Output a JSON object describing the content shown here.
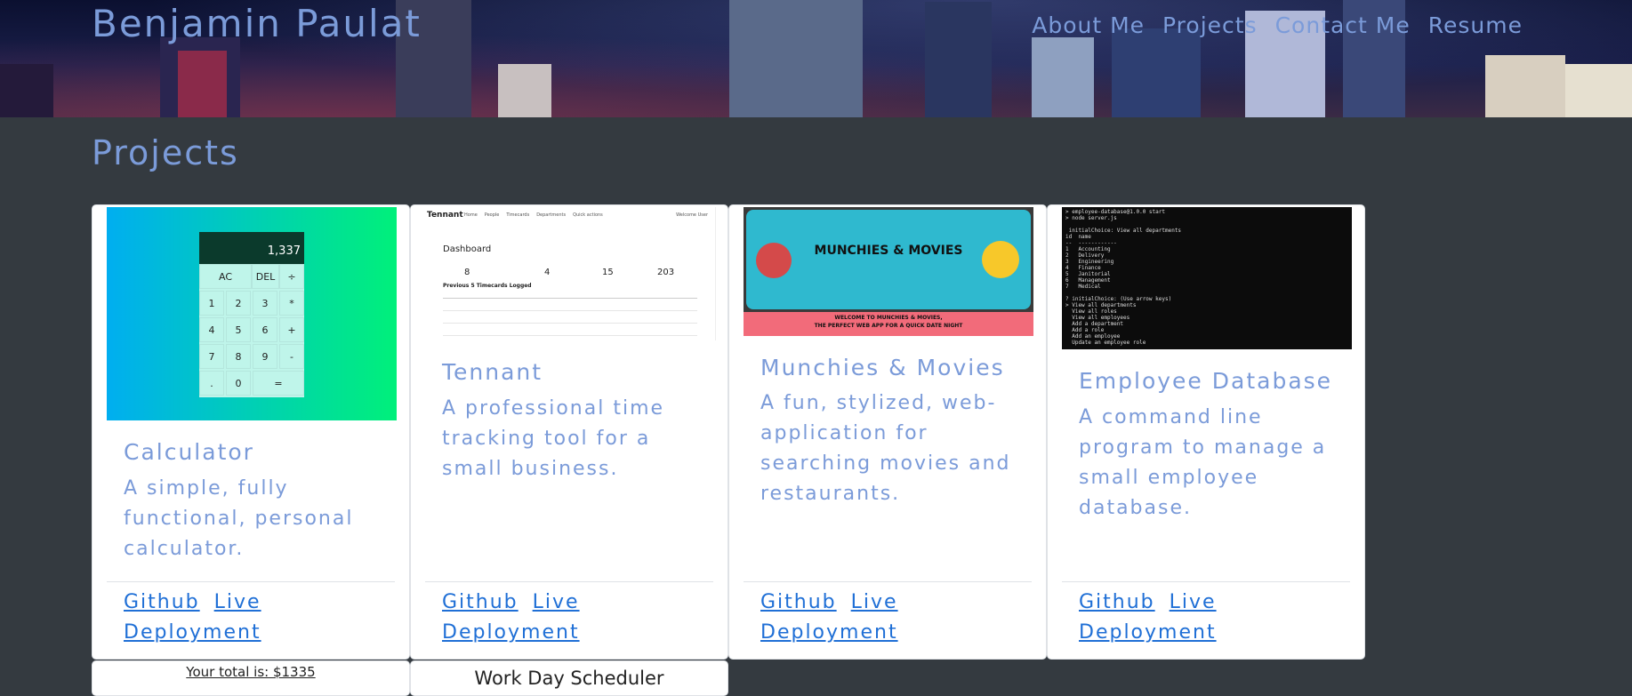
{
  "header": {
    "site_title": "Benjamin Paulat",
    "nav": [
      "About Me",
      "Projects",
      "Contact Me",
      "Resume"
    ]
  },
  "section_title": "Projects",
  "projects": [
    {
      "title": "Calculator",
      "description": "A simple, fully functional, personal calculator.",
      "github_label": "Github",
      "live_label": "Live Deployment",
      "screen_value": "1,337"
    },
    {
      "title": "Tennant",
      "description": "A professional time tracking tool for a small business.",
      "github_label": "Github",
      "live_label": "Live Deployment",
      "preview": {
        "brand": "Tennant",
        "menu": [
          "Home",
          "People",
          "Timecards",
          "Departments",
          "Quick actions"
        ],
        "welcome": "Welcome User",
        "heading": "Dashboard",
        "stats": [
          "8",
          "4",
          "15",
          "203"
        ],
        "subheading": "Previous 5 Timecards Logged"
      }
    },
    {
      "title": "Munchies & Movies",
      "description": "A fun, stylized, web-application for searching movies and restaurants.",
      "github_label": "Github",
      "live_label": "Live Deployment",
      "banner_title": "MUNCHIES & MOVIES",
      "banner_sub1": "WELCOME TO MUNCHIES & MOVIES,",
      "banner_sub2": "THE PERFECT WEB APP FOR A QUICK DATE NIGHT"
    },
    {
      "title": "Employee Database",
      "description": "A command line program to manage a small employee database.",
      "github_label": "Github",
      "live_label": "Live Deployment"
    }
  ],
  "next_row": {
    "card1_text": "Your total is: $1335",
    "card2_text": "Work Day Scheduler"
  },
  "colors": {
    "accent": "#7b9bd9",
    "link": "#1f6fd6",
    "background": "#343a40"
  }
}
